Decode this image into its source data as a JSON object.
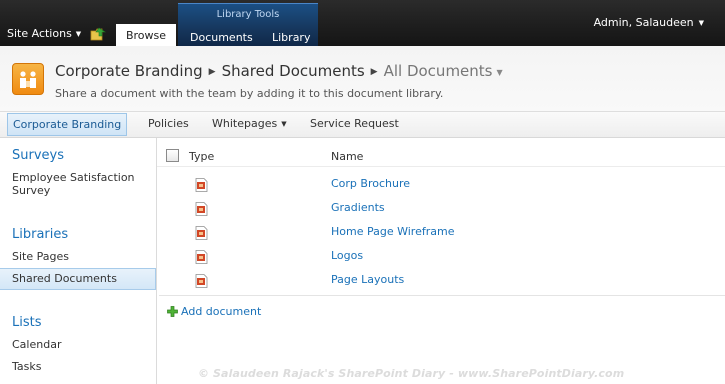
{
  "ribbon": {
    "site_actions_label": "Site Actions",
    "browse_tab_label": "Browse",
    "contextual_group_label": "Library Tools",
    "documents_tab_label": "Documents",
    "library_tab_label": "Library",
    "user_name": "Admin, Salaudeen",
    "colors": {
      "ribbon_bg": "#1e1e1e",
      "contextual_bg": "#16365c"
    },
    "icons": {
      "navigate_up": "folder-up-arrow-icon",
      "dropdown": "caret-down-icon"
    }
  },
  "title_area": {
    "breadcrumb": [
      "Corporate Branding",
      "Shared Documents"
    ],
    "current_view": "All Documents",
    "description": "Share a document with the team by adding it to this document library.",
    "icons": {
      "logo": "people-logo-icon",
      "separator": "triangle-right-icon"
    }
  },
  "top_nav": {
    "items": [
      {
        "label": "Corporate Branding",
        "selected": true,
        "has_dropdown": false
      },
      {
        "label": "Policies",
        "selected": false,
        "has_dropdown": false
      },
      {
        "label": "Whitepages",
        "selected": false,
        "has_dropdown": true
      },
      {
        "label": "Service Request",
        "selected": false,
        "has_dropdown": false
      }
    ]
  },
  "quick_launch": {
    "sections": [
      {
        "heading": "Surveys",
        "items": [
          {
            "label": "Employee Satisfaction Survey",
            "selected": false
          }
        ]
      },
      {
        "heading": "Libraries",
        "items": [
          {
            "label": "Site Pages",
            "selected": false
          },
          {
            "label": "Shared Documents",
            "selected": true
          }
        ]
      },
      {
        "heading": "Lists",
        "items": [
          {
            "label": "Calendar",
            "selected": false
          },
          {
            "label": "Tasks",
            "selected": false
          }
        ]
      }
    ]
  },
  "document_list": {
    "columns": [
      "Type",
      "Name"
    ],
    "rows": [
      {
        "type_icon": "powerpoint-file-icon",
        "name": "Corp Brochure"
      },
      {
        "type_icon": "powerpoint-file-icon",
        "name": "Gradients"
      },
      {
        "type_icon": "powerpoint-file-icon",
        "name": "Home Page Wireframe"
      },
      {
        "type_icon": "powerpoint-file-icon",
        "name": "Logos"
      },
      {
        "type_icon": "powerpoint-file-icon",
        "name": "Page Layouts"
      }
    ],
    "add_document_label": "Add document",
    "link_color": "#1a71b8"
  },
  "watermark": "© Salaudeen Rajack's SharePoint Diary - www.SharePointDiary.com"
}
